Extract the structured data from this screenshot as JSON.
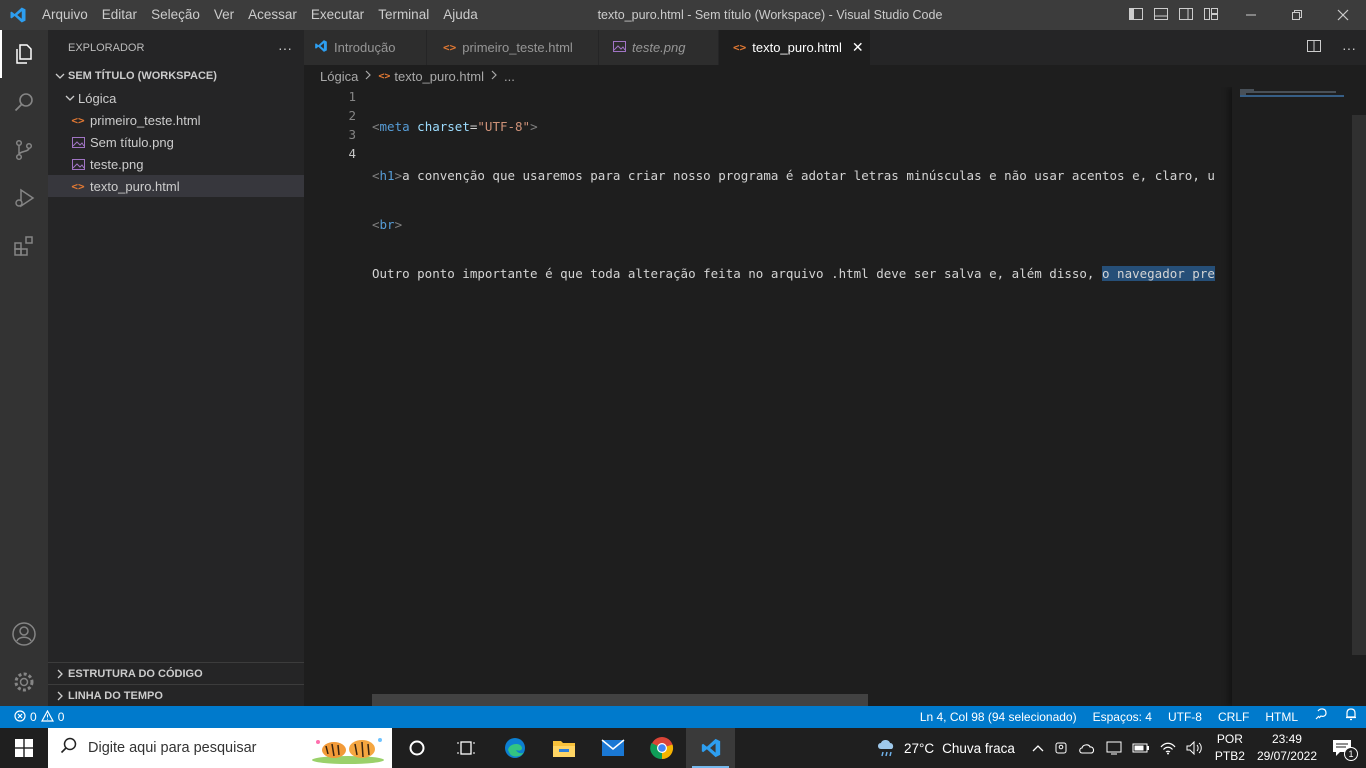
{
  "titlebar": {
    "menu": [
      "Arquivo",
      "Editar",
      "Seleção",
      "Ver",
      "Acessar",
      "Executar",
      "Terminal",
      "Ajuda"
    ],
    "window_title": "texto_puro.html - Sem título (Workspace) - Visual Studio Code"
  },
  "activitybar": {
    "items": [
      "explorer-icon",
      "search-icon",
      "source-control-icon",
      "run-debug-icon",
      "extensions-icon"
    ],
    "bottom": [
      "account-icon",
      "settings-gear-icon"
    ]
  },
  "sidebar": {
    "title": "EXPLORADOR",
    "more": "···",
    "workspace": "SEM TÍTULO (WORKSPACE)",
    "folder": "Lógica",
    "files": [
      {
        "name": "primeiro_teste.html",
        "type": "html"
      },
      {
        "name": "Sem título.png",
        "type": "image"
      },
      {
        "name": "teste.png",
        "type": "image"
      },
      {
        "name": "texto_puro.html",
        "type": "html"
      }
    ],
    "outline": "ESTRUTURA DO CÓDIGO",
    "timeline": "LINHA DO TEMPO"
  },
  "tabs": [
    {
      "label": "Introdução",
      "icon": "vscode-icon"
    },
    {
      "label": "primeiro_teste.html",
      "icon": "html-icon"
    },
    {
      "label": "teste.png",
      "icon": "image-icon"
    },
    {
      "label": "texto_puro.html",
      "icon": "html-icon",
      "active": true,
      "close": "✕"
    }
  ],
  "breadcrumb": {
    "folder": "Lógica",
    "file": "texto_puro.html",
    "more": "..."
  },
  "editor": {
    "line_numbers": [
      "1",
      "2",
      "3",
      "4"
    ],
    "line1": {
      "open": "<",
      "tag": "meta",
      "attr": "charset",
      "eq": "=",
      "value": "\"UTF-8\"",
      "close": ">"
    },
    "line2": {
      "open": "<",
      "tag": "h1",
      "close": ">",
      "text": "a convenção que usaremos para criar nosso programa é adotar letras minúsculas e não usar acentos e, claro, u"
    },
    "line3": {
      "open": "<",
      "tag": "br",
      "close": ">"
    },
    "line4": {
      "text": "Outro ponto importante é que toda alteração feita no arquivo .html deve ser salva e, além disso, ",
      "selected": "o navegador pre"
    }
  },
  "statusbar": {
    "errors": "0",
    "warnings": "0",
    "position": "Ln 4, Col 98 (94 selecionado)",
    "spaces": "Espaços: 4",
    "encoding": "UTF-8",
    "eol": "CRLF",
    "language": "HTML"
  },
  "taskbar": {
    "search_placeholder": "Digite aqui para pesquisar",
    "apps": [
      "task-view-icon",
      "edge-icon",
      "file-explorer-icon",
      "mail-icon",
      "chrome-icon",
      "vscode-icon"
    ],
    "weather": {
      "temp": "27°C",
      "desc": "Chuva fraca"
    },
    "lang": {
      "line1": "POR",
      "line2": "PTB2"
    },
    "clock": {
      "time": "23:49",
      "date": "29/07/2022"
    },
    "notifications": "1"
  },
  "colors": {
    "accent": "#007acc",
    "titlebar": "#3c3c3c",
    "sidebar": "#252526",
    "editor": "#1e1e1e",
    "html_icon": "#e37933",
    "image_icon": "#a074c4"
  }
}
